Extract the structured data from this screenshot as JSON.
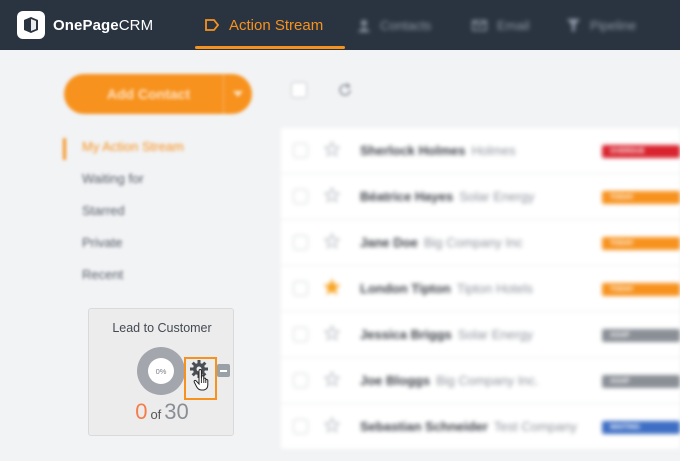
{
  "app": {
    "logo_bold": "OnePage",
    "logo_light": "CRM"
  },
  "nav": {
    "items": [
      {
        "label": "Action Stream",
        "icon": "action-stream-icon",
        "active": true
      },
      {
        "label": "Contacts",
        "icon": "contacts-icon",
        "active": false
      },
      {
        "label": "Email",
        "icon": "email-icon",
        "active": false
      },
      {
        "label": "Pipeline",
        "icon": "pipeline-icon",
        "active": false
      }
    ]
  },
  "add_button": {
    "label": "Add Contact"
  },
  "sidebar": {
    "items": [
      {
        "label": "My Action Stream",
        "active": true
      },
      {
        "label": "Waiting for",
        "active": false
      },
      {
        "label": "Starred",
        "active": false
      },
      {
        "label": "Private",
        "active": false
      },
      {
        "label": "Recent",
        "active": false
      }
    ]
  },
  "widget": {
    "title": "Lead to Customer",
    "percent_label": "0%",
    "count_current": "0",
    "count_of": "of",
    "count_total": "30"
  },
  "contacts": [
    {
      "name": "Sherlock Holmes",
      "company": "Holmes",
      "starred": false,
      "tag": "OVERDUE",
      "tag_color": "#d9232e"
    },
    {
      "name": "Béatrice Hayes",
      "company": "Solar Energy",
      "starred": false,
      "tag": "TODAY",
      "tag_color": "#f7921e"
    },
    {
      "name": "Jane Doe",
      "company": "Big Company Inc",
      "starred": false,
      "tag": "TODAY",
      "tag_color": "#f7921e"
    },
    {
      "name": "London Tipton",
      "company": "Tipton Hotels",
      "starred": true,
      "tag": "TODAY",
      "tag_color": "#f7921e"
    },
    {
      "name": "Jessica Briggs",
      "company": "Solar Energy",
      "starred": false,
      "tag": "ASAP",
      "tag_color": "#8a8f96"
    },
    {
      "name": "Joe Bloggs",
      "company": "Big Company Inc.",
      "starred": false,
      "tag": "ASAP",
      "tag_color": "#8a8f96"
    },
    {
      "name": "Sebastian Schneider",
      "company": "Test Company",
      "starred": false,
      "tag": "WAITING",
      "tag_color": "#3f6fc4"
    }
  ],
  "colors": {
    "accent": "#f7921e",
    "topbar": "#2a3441"
  }
}
